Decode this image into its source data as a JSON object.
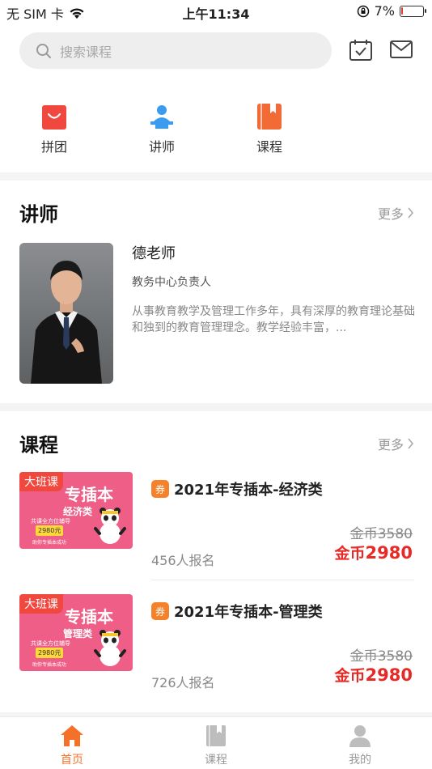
{
  "status": {
    "carrier": "无 SIM 卡",
    "time": "上午11:34",
    "battery": "7%"
  },
  "search": {
    "placeholder": "搜索课程"
  },
  "quick_nav": [
    {
      "label": "拼团",
      "icon": "shopping-bag-icon"
    },
    {
      "label": "讲师",
      "icon": "lecturer-icon"
    },
    {
      "label": "课程",
      "icon": "book-icon"
    }
  ],
  "teachers": {
    "title": "讲师",
    "more": "更多",
    "items": [
      {
        "name": "德老师",
        "role": "教务中心负责人",
        "desc": "从事教育教学及管理工作多年，具有深厚的教育理论基础和独到的教育管理理念。教学经验丰富，..."
      }
    ]
  },
  "courses": {
    "title": "课程",
    "more": "更多",
    "items": [
      {
        "tag": "大班课",
        "cover_title": "专插本",
        "cover_subtitle": "经济类",
        "cover_note": "共课全方位辅导",
        "cover_price": "2980元",
        "cover_footer": "助你专插本成功",
        "coupon": "券",
        "name": "2021年专插本-经济类",
        "original_price": "金币3580",
        "price_unit": "金币",
        "price": "2980",
        "enrolled": "456人报名"
      },
      {
        "tag": "大班课",
        "cover_title": "专插本",
        "cover_subtitle": "管理类",
        "cover_note": "共课全方位辅导",
        "cover_price": "2980元",
        "cover_footer": "助你专插本成功",
        "coupon": "券",
        "name": "2021年专插本-管理类",
        "original_price": "金币3580",
        "price_unit": "金币",
        "price": "2980",
        "enrolled": "726人报名"
      }
    ]
  },
  "tabbar": [
    {
      "label": "首页",
      "active": true
    },
    {
      "label": "课程",
      "active": false
    },
    {
      "label": "我的",
      "active": false
    }
  ],
  "colors": {
    "accent": "#f5712a",
    "price_red": "#e82a26",
    "cover_pink": "#ee5e86"
  }
}
